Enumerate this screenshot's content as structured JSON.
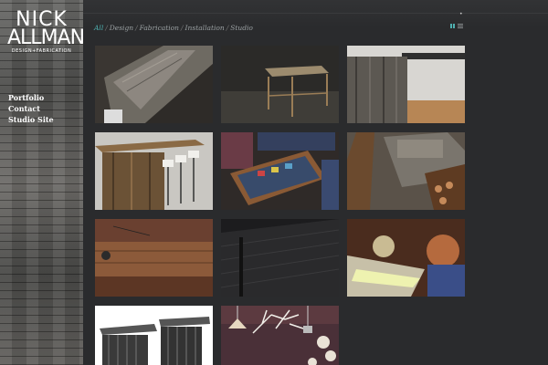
{
  "logo": {
    "line1": "NICK",
    "line2": "ALLMAN",
    "line3": "DESIGN+FABRICATION"
  },
  "nav": {
    "items": [
      {
        "label": "Portfolio"
      },
      {
        "label": "Contact"
      },
      {
        "label": "Studio Site"
      }
    ]
  },
  "filters": {
    "items": [
      {
        "label": "All",
        "active": true
      },
      {
        "label": "Design",
        "active": false
      },
      {
        "label": "Fabrication",
        "active": false
      },
      {
        "label": "Installation",
        "active": false
      },
      {
        "label": "Studio",
        "active": false
      }
    ],
    "separator": "/"
  },
  "topbar": {
    "marker": "•"
  },
  "view_toggle": {
    "active": "grid"
  },
  "colors": {
    "accent": "#4fb0b0",
    "background": "#2a2b2d",
    "sidebar_text": "#ffffff",
    "filter_text": "#9aa0a2"
  }
}
